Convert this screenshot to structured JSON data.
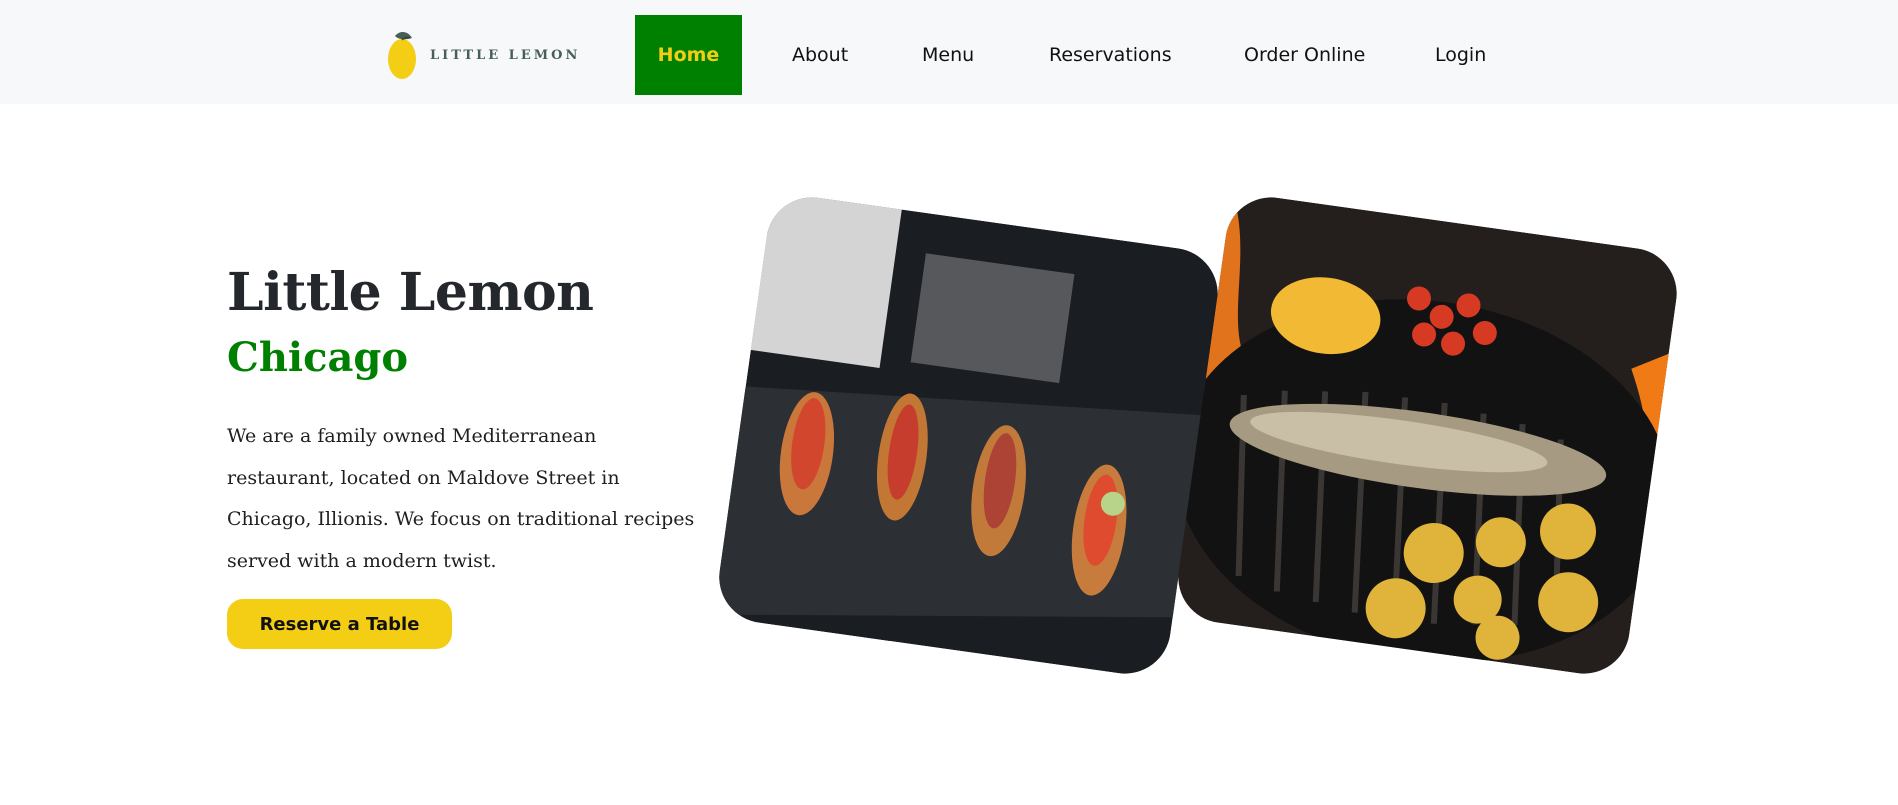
{
  "nav": {
    "logo_text": "LITTLE LEMON",
    "logo_icon": "lemon-icon",
    "items": [
      {
        "label": "Home",
        "active": true
      },
      {
        "label": "About"
      },
      {
        "label": "Menu"
      },
      {
        "label": "Reservations"
      },
      {
        "label": "Order Online"
      },
      {
        "label": "Login"
      }
    ]
  },
  "hero": {
    "title": "Little Lemon",
    "subtitle": "Chicago",
    "description": "We are a family owned Mediterranean restaurant, located on Maldove Street in Chicago, Illionis. We focus on traditional recipes served with a modern twist.",
    "cta_label": "Reserve a Table"
  },
  "colors": {
    "primary_green": "#008000",
    "accent_yellow": "#f4ce14",
    "nav_background": "#f7f8f9",
    "text_dark": "#24272c"
  }
}
